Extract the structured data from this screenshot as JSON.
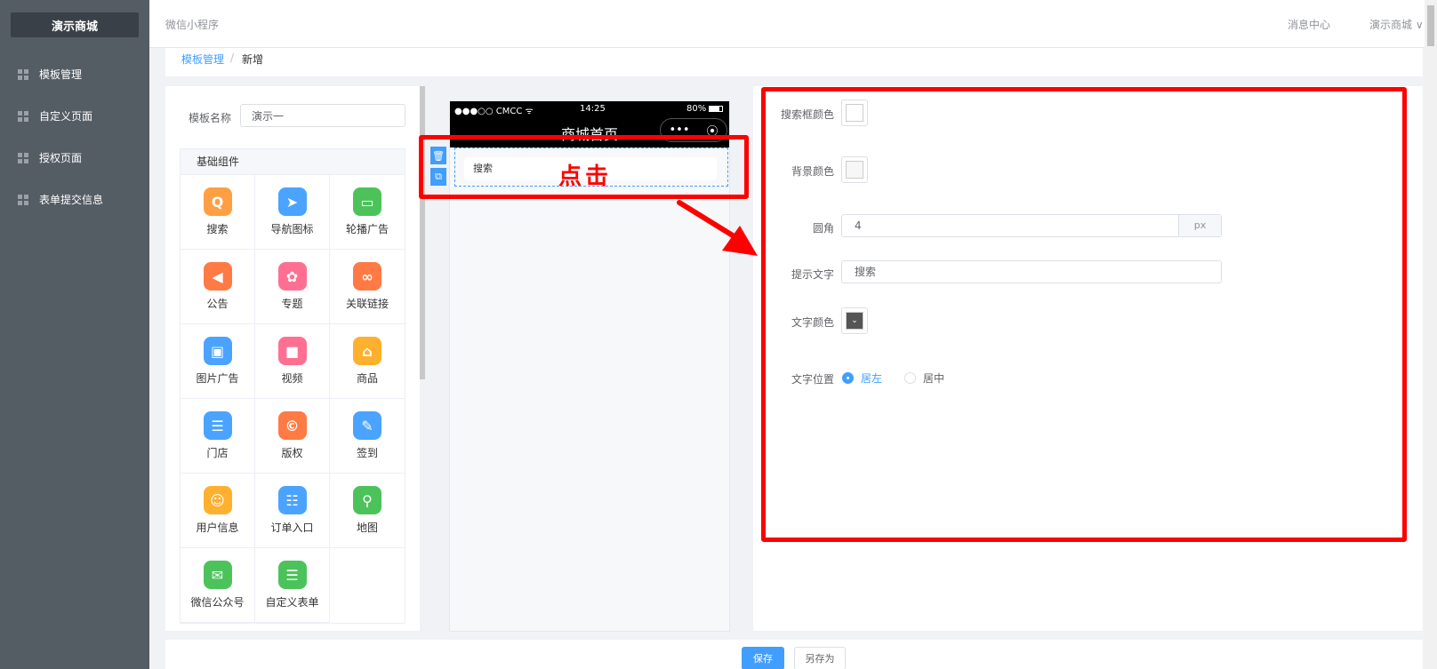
{
  "sidebar": {
    "logo": "演示商城",
    "items": [
      {
        "label": "模板管理"
      },
      {
        "label": "自定义页面"
      },
      {
        "label": "授权页面"
      },
      {
        "label": "表单提交信息"
      }
    ]
  },
  "header": {
    "app_title": "微信小程序",
    "message_center": "消息中心",
    "user_menu": "演示商城 ∨"
  },
  "breadcrumb": {
    "parent": "模板管理",
    "separator": "/",
    "current": "新增"
  },
  "template_form": {
    "name_label": "模板名称",
    "name_value": "演示一"
  },
  "components": {
    "group_title": "基础组件",
    "items": [
      {
        "label": "搜索",
        "icon": "search-icon",
        "color": "#ff9f43",
        "glyph": "Q"
      },
      {
        "label": "导航图标",
        "icon": "navigation-icon",
        "color": "#4aa3ff",
        "glyph": "➤"
      },
      {
        "label": "轮播广告",
        "icon": "carousel-icon",
        "color": "#4cc35a",
        "glyph": "▭"
      },
      {
        "label": "公告",
        "icon": "announcement-icon",
        "color": "#ff7a45",
        "glyph": "◀"
      },
      {
        "label": "专题",
        "icon": "topic-icon",
        "color": "#ff6f91",
        "glyph": "✿"
      },
      {
        "label": "关联链接",
        "icon": "link-icon",
        "color": "#ff7a45",
        "glyph": "∞"
      },
      {
        "label": "图片广告",
        "icon": "image-ad-icon",
        "color": "#4aa3ff",
        "glyph": "▣"
      },
      {
        "label": "视频",
        "icon": "video-icon",
        "color": "#ff6f91",
        "glyph": "■"
      },
      {
        "label": "商品",
        "icon": "goods-icon",
        "color": "#ffb02e",
        "glyph": "⌂"
      },
      {
        "label": "门店",
        "icon": "store-icon",
        "color": "#4aa3ff",
        "glyph": "☰"
      },
      {
        "label": "版权",
        "icon": "copyright-icon",
        "color": "#ff7a45",
        "glyph": "©"
      },
      {
        "label": "签到",
        "icon": "signin-icon",
        "color": "#4aa3ff",
        "glyph": "✎"
      },
      {
        "label": "用户信息",
        "icon": "user-info-icon",
        "color": "#ffb02e",
        "glyph": "☺"
      },
      {
        "label": "订单入口",
        "icon": "order-icon",
        "color": "#4aa3ff",
        "glyph": "☷"
      },
      {
        "label": "地图",
        "icon": "map-icon",
        "color": "#4cc35a",
        "glyph": "⚲"
      },
      {
        "label": "微信公众号",
        "icon": "wechat-icon",
        "color": "#4cc35a",
        "glyph": "✉"
      },
      {
        "label": "自定义表单",
        "icon": "custom-form-icon",
        "color": "#4cc35a",
        "glyph": "☰"
      }
    ]
  },
  "phone": {
    "carrier": "●●●○○ CMCC ᯤ",
    "time": "14:25",
    "battery": "80%",
    "page_title": "商城首页",
    "capsule_more": "•••",
    "capsule_close": "⦿",
    "search_text": "搜索",
    "delete_icon": "🗑",
    "copy_icon": "⧉"
  },
  "annotation": {
    "click_text": "点击"
  },
  "properties": {
    "search_box_color_label": "搜索框颜色",
    "search_box_color": "#ffffff",
    "bg_color_label": "背景颜色",
    "bg_color": "#f7f7f7",
    "radius_label": "圆角",
    "radius_value": "4",
    "radius_unit": "px",
    "hint_label": "提示文字",
    "hint_value": "搜索",
    "text_color_label": "文字颜色",
    "text_color": "#555555",
    "text_pos_label": "文字位置",
    "pos_left": "居左",
    "pos_center": "居中"
  },
  "footer": {
    "save": "保存",
    "save_as": "另存为"
  },
  "colors": {
    "accent": "#409eff",
    "annotation": "#ff0000",
    "sidebar_bg": "#545c64"
  }
}
